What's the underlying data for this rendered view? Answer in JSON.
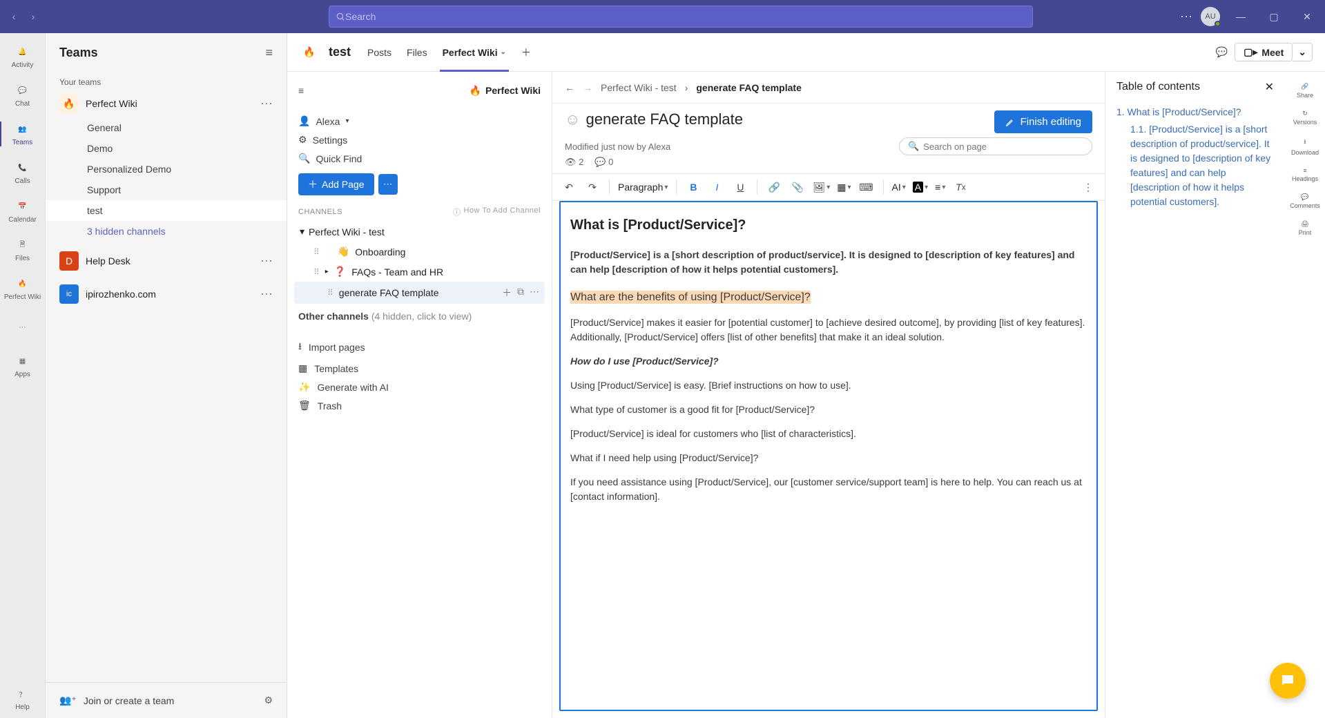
{
  "titlebar": {
    "search_placeholder": "Search",
    "avatar_initials": "AU"
  },
  "apprail": [
    {
      "label": "Activity"
    },
    {
      "label": "Chat"
    },
    {
      "label": "Teams"
    },
    {
      "label": "Calls"
    },
    {
      "label": "Calendar"
    },
    {
      "label": "Files"
    },
    {
      "label": "Perfect Wiki"
    }
  ],
  "apprail_more": {
    "label": "Apps"
  },
  "apprail_help": {
    "label": "Help"
  },
  "teams_panel": {
    "title": "Teams",
    "section": "Your teams",
    "teams": [
      {
        "name": "Perfect Wiki",
        "icon": "🔥",
        "bg": "#fff3e0",
        "channels": [
          "General",
          "Demo",
          "Personalized Demo",
          "Support",
          "test"
        ],
        "hidden": "3 hidden channels",
        "active": "test"
      },
      {
        "name": "Help Desk",
        "icon": "D",
        "bg": "#d84315"
      },
      {
        "name": "ipirozhenko.com",
        "icon": "ic",
        "bg": "#1f74db"
      }
    ],
    "footer": "Join or create a team"
  },
  "tab_header": {
    "channel": "test",
    "tabs": [
      "Posts",
      "Files",
      "Perfect Wiki"
    ],
    "active": "Perfect Wiki",
    "meet": "Meet"
  },
  "pw_nav": {
    "brand": "Perfect Wiki",
    "user": "Alexa",
    "menu": [
      "Settings",
      "Quick Find"
    ],
    "add_page": "Add Page",
    "channels_label": "CHANNELS",
    "howto": "How To Add Channel",
    "group": "Perfect Wiki - test",
    "pages": [
      {
        "label": "Onboarding",
        "icon": "👋"
      },
      {
        "label": "FAQs - Team and HR",
        "icon": "❓",
        "expandable": true
      },
      {
        "label": "generate FAQ template",
        "selected": true,
        "sub": true
      }
    ],
    "other": "Other channels",
    "other_hint": "(4 hidden, click to view)",
    "footer": [
      "Import pages",
      "Templates",
      "Generate with AI",
      "Trash"
    ]
  },
  "editor": {
    "crumb_root": "Perfect Wiki - test",
    "crumb_page": "generate FAQ template",
    "title": "generate FAQ template",
    "finish": "Finish editing",
    "modified": "Modified just now by Alexa",
    "views": "2",
    "comments": "0",
    "search_placeholder": "Search on page",
    "style_select": "Paragraph",
    "ai_label": "AI",
    "doc": {
      "h1": "What is [Product/Service]?",
      "p1": "[Product/Service] is a [short description of product/service]. It is designed to [description of key features] and can help [description of how it helps potential customers].",
      "h2": "What are the benefits of using [Product/Service]?",
      "p2": "[Product/Service] makes it easier for [potential customer] to [achieve desired outcome], by providing [list of key features]. Additionally, [Product/Service] offers [list of other benefits] that make it an ideal solution.",
      "h3": "How do I use [Product/Service]?",
      "p3": "Using [Product/Service] is easy. [Brief instructions on how to use].",
      "h4": "What type of customer is a good fit for [Product/Service]?",
      "p4": "[Product/Service] is ideal for customers who [list of characteristics].",
      "h5": "What if I need help using [Product/Service]?",
      "p5": "If you need assistance using [Product/Service], our [customer service/support team] is here to help. You can reach us at [contact information]."
    }
  },
  "toc": {
    "title": "Table of contents",
    "items": [
      {
        "num": "1.",
        "label": "What is [Product/Service]?"
      },
      {
        "num": "1.1.",
        "label": "[Product/Service] is a [short description of product/service]. It is designed to [description of key features] and can help [description of how it helps potential customers].",
        "sub": true
      }
    ]
  },
  "right_rail": [
    "Share",
    "Versions",
    "Download",
    "Headings",
    "Comments",
    "Print"
  ]
}
